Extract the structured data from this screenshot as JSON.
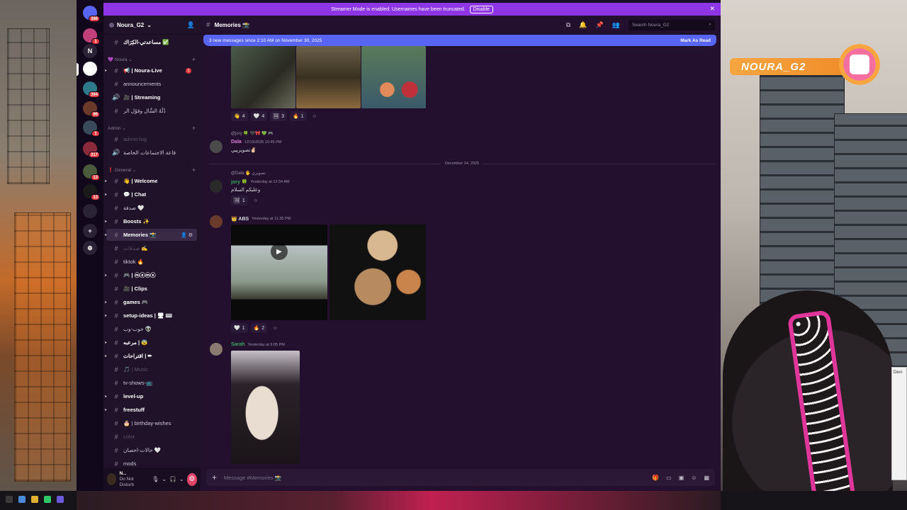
{
  "streamer": {
    "text": "Streamer Mode is enabled. Usernames have been truncated.",
    "disable": "Disable",
    "close": "✕"
  },
  "servers": [
    {
      "label": "",
      "badge": "386",
      "color": "#5865f2"
    },
    {
      "label": "",
      "badge": "1",
      "color": "#c0407a"
    },
    {
      "label": "N",
      "badge": "",
      "color": "#2a2235"
    },
    {
      "label": "",
      "badge": "",
      "color": "#ffffff"
    },
    {
      "label": "",
      "badge": "394",
      "color": "#2f7a8a"
    },
    {
      "label": "",
      "badge": "96",
      "color": "#6a3a2a"
    },
    {
      "label": "",
      "badge": "1",
      "color": "#3a4a5a"
    },
    {
      "label": "",
      "badge": "317",
      "color": "#8a2a3a"
    },
    {
      "label": "",
      "badge": "13",
      "color": "#4a5a3a"
    },
    {
      "label": "",
      "badge": "13",
      "color": "#1a1a1a"
    },
    {
      "label": "",
      "badge": "",
      "color": "#2a2235"
    },
    {
      "label": "+",
      "badge": "",
      "color": "#2a2235"
    },
    {
      "label": "⊕",
      "badge": "",
      "color": "#2a2235"
    }
  ],
  "guild": {
    "name": "Noura_G2"
  },
  "channels": [
    {
      "type": "ch",
      "icon": "#",
      "label": "مساعدتي-الكِرَاك ✅",
      "style": "bold"
    },
    {
      "type": "cat",
      "label": "💜 Noura"
    },
    {
      "type": "ch",
      "icon": "#",
      "label": "📢 | Noura-Live",
      "style": "bold",
      "count": "1",
      "arrow": true
    },
    {
      "type": "ch",
      "icon": "#",
      "label": "announcements",
      "style": ""
    },
    {
      "type": "ch",
      "icon": "🔊",
      "label": "🎥 | Streaming",
      "style": "bold"
    },
    {
      "type": "ch",
      "icon": "#",
      "label": "دُلَّهُ السُّال وقوُل الر",
      "style": ""
    },
    {
      "type": "cat",
      "label": "Admin"
    },
    {
      "type": "ch",
      "icon": "#",
      "label": "admin-log",
      "style": "muted"
    },
    {
      "type": "ch",
      "icon": "🔊",
      "label": "قاعة الاجتماعات الخاصة",
      "style": ""
    },
    {
      "type": "cat",
      "label": "❗ General"
    },
    {
      "type": "ch",
      "icon": "#",
      "label": "👋 | Welcome",
      "style": "bold",
      "arrow": true
    },
    {
      "type": "ch",
      "icon": "#",
      "label": "💬 | Chat",
      "style": "bold",
      "arrow": true
    },
    {
      "type": "ch",
      "icon": "#",
      "label": "صدقة 🤍",
      "style": ""
    },
    {
      "type": "ch",
      "icon": "#",
      "label": "Boosts ✨",
      "style": "bold",
      "arrow": true
    },
    {
      "type": "ch",
      "icon": "#",
      "label": "Memories 📸",
      "style": "sel",
      "arrow": true,
      "sel": true
    },
    {
      "type": "ch",
      "icon": "#",
      "label": "صدقات ✍",
      "style": "muted"
    },
    {
      "type": "ch",
      "icon": "#",
      "label": "tiktok 🔥",
      "style": ""
    },
    {
      "type": "ch",
      "icon": "#",
      "label": "🎮 | ⓜⓔⓜⓔ",
      "style": "bold",
      "arrow": true
    },
    {
      "type": "ch",
      "icon": "#",
      "label": "🎥 | Clips",
      "style": "bold"
    },
    {
      "type": "ch",
      "icon": "#",
      "label": "games 🎮",
      "style": "bold",
      "arrow": true
    },
    {
      "type": "ch",
      "icon": "#",
      "label": "setup-ideas | 🖥 ⌨",
      "style": "bold",
      "arrow": true
    },
    {
      "type": "ch",
      "icon": "#",
      "label": "حوب-وب 👽",
      "style": ""
    },
    {
      "type": "ch",
      "icon": "#",
      "label": "مرعبه | 😨",
      "style": "bold",
      "arrow": true
    },
    {
      "type": "ch",
      "icon": "#",
      "label": "اقتراحات | ✏",
      "style": "bold",
      "arrow": true
    },
    {
      "type": "ch",
      "icon": "#",
      "label": "🎵 | Music",
      "style": "muted"
    },
    {
      "type": "ch",
      "icon": "#",
      "label": "tv-shows-📺",
      "style": ""
    },
    {
      "type": "ch",
      "icon": "#",
      "label": "level-up",
      "style": "bold",
      "arrow": true
    },
    {
      "type": "ch",
      "icon": "#",
      "label": "freestuff",
      "style": "bold",
      "arrow": true
    },
    {
      "type": "ch",
      "icon": "#",
      "label": "🎂 | birthday-wishes",
      "style": ""
    },
    {
      "type": "ch",
      "icon": "#",
      "label": "color",
      "style": "muted"
    },
    {
      "type": "ch",
      "icon": "#",
      "label": "حالات-احصان 🤍",
      "style": ""
    },
    {
      "type": "ch",
      "icon": "#",
      "label": "mods",
      "style": ""
    }
  ],
  "user": {
    "name": "N...",
    "status": "Do Not Disturb"
  },
  "topbar": {
    "channel": "Memories 📸",
    "search": "Search Noura_G2"
  },
  "newbar": {
    "text": "3 new messages since 2:10 AM on November 30, 2025",
    "mark": "Mark As Read"
  },
  "messages": {
    "r1": [
      {
        "e": "👋",
        "n": "4"
      },
      {
        "e": "🤍",
        "n": "4"
      },
      {
        "e": "🖼",
        "n": "3"
      },
      {
        "e": "🔥",
        "n": "1"
      }
    ],
    "m2": {
      "reply": "@jory 🍀 🖤🎀 💚 🎮",
      "name": "Dala",
      "time": "12/13/2025 10:45 PM",
      "text": "تصويرييي✌🏻",
      "color": "#e27ad6"
    },
    "divider": "December 14, 2025",
    "m3": {
      "reply": "@Dala 🖐 تصويري",
      "name": "jory 🍀",
      "time": "Yesterday at 12:34 AM",
      "text": "وعليكم السلام",
      "color": "#3ba55c"
    },
    "r3": [
      {
        "e": "🖼",
        "n": "1"
      }
    ],
    "m4": {
      "name": "👑 ABS",
      "time": "Yesterday at 11:35 PM",
      "color": "#dbdee1"
    },
    "r4": [
      {
        "e": "🤍",
        "n": "1"
      },
      {
        "e": "🔥",
        "n": "2"
      }
    ],
    "m5": {
      "name": "Sarah",
      "time": "Yesterday at 9:05 PM",
      "color": "#3ba55c"
    }
  },
  "composer": {
    "placeholder": "Message #Memories 📸"
  },
  "overlay": {
    "name": "NOURA_G2"
  },
  "colors": {
    "accent": "#5865f2",
    "streamer": "#8e36e6",
    "bg": "#23102f"
  }
}
